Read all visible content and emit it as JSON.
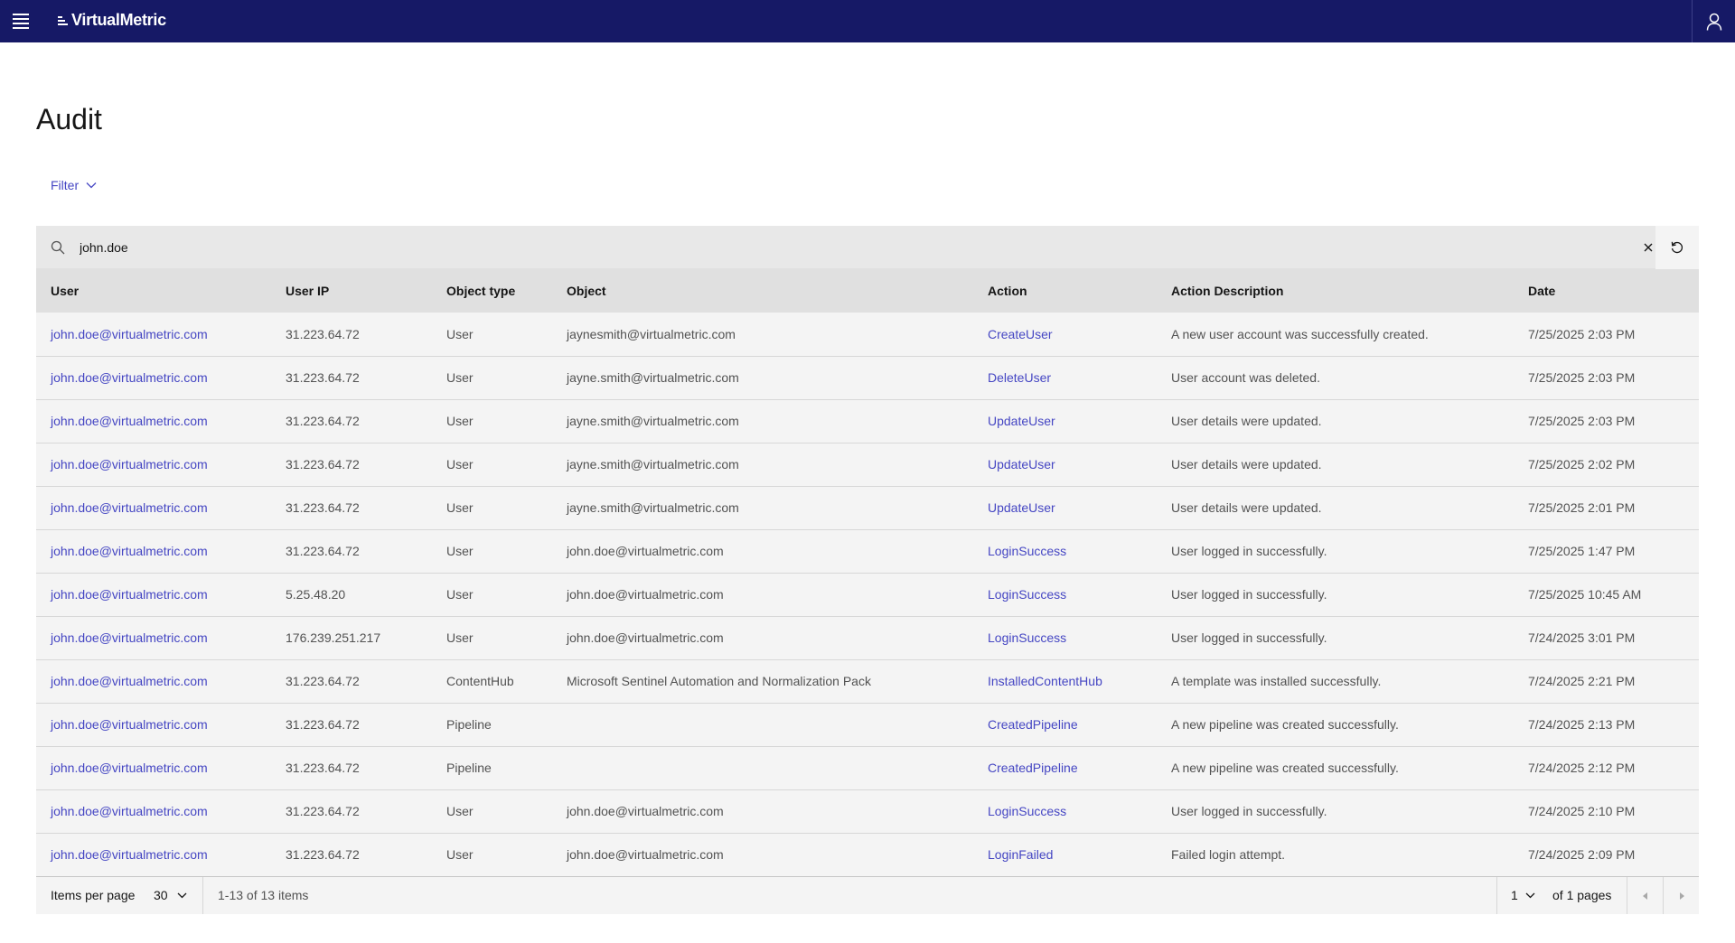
{
  "header": {
    "brand": "VirtualMetric"
  },
  "page": {
    "title": "Audit"
  },
  "filter": {
    "label": "Filter"
  },
  "search": {
    "value": "john.doe"
  },
  "table": {
    "columns": [
      "User",
      "User IP",
      "Object type",
      "Object",
      "Action",
      "Action Description",
      "Date"
    ],
    "rows": [
      {
        "user": "john.doe@virtualmetric.com",
        "ip": "31.223.64.72",
        "object_type": "User",
        "object": "jaynesmith@virtualmetric.com",
        "action": "CreateUser",
        "description": "A new user account was successfully created.",
        "date": "7/25/2025 2:03 PM"
      },
      {
        "user": "john.doe@virtualmetric.com",
        "ip": "31.223.64.72",
        "object_type": "User",
        "object": "jayne.smith@virtualmetric.com",
        "action": "DeleteUser",
        "description": "User account was deleted.",
        "date": "7/25/2025 2:03 PM"
      },
      {
        "user": "john.doe@virtualmetric.com",
        "ip": "31.223.64.72",
        "object_type": "User",
        "object": "jayne.smith@virtualmetric.com",
        "action": "UpdateUser",
        "description": "User details were updated.",
        "date": "7/25/2025 2:03 PM"
      },
      {
        "user": "john.doe@virtualmetric.com",
        "ip": "31.223.64.72",
        "object_type": "User",
        "object": "jayne.smith@virtualmetric.com",
        "action": "UpdateUser",
        "description": "User details were updated.",
        "date": "7/25/2025 2:02 PM"
      },
      {
        "user": "john.doe@virtualmetric.com",
        "ip": "31.223.64.72",
        "object_type": "User",
        "object": "jayne.smith@virtualmetric.com",
        "action": "UpdateUser",
        "description": "User details were updated.",
        "date": "7/25/2025 2:01 PM"
      },
      {
        "user": "john.doe@virtualmetric.com",
        "ip": "31.223.64.72",
        "object_type": "User",
        "object": "john.doe@virtualmetric.com",
        "action": "LoginSuccess",
        "description": "User logged in successfully.",
        "date": "7/25/2025 1:47 PM"
      },
      {
        "user": "john.doe@virtualmetric.com",
        "ip": "5.25.48.20",
        "object_type": "User",
        "object": "john.doe@virtualmetric.com",
        "action": "LoginSuccess",
        "description": "User logged in successfully.",
        "date": "7/25/2025 10:45 AM"
      },
      {
        "user": "john.doe@virtualmetric.com",
        "ip": "176.239.251.217",
        "object_type": "User",
        "object": "john.doe@virtualmetric.com",
        "action": "LoginSuccess",
        "description": "User logged in successfully.",
        "date": "7/24/2025 3:01 PM"
      },
      {
        "user": "john.doe@virtualmetric.com",
        "ip": "31.223.64.72",
        "object_type": "ContentHub",
        "object": "Microsoft Sentinel Automation and Normalization Pack",
        "action": "InstalledContentHub",
        "description": "A template was installed successfully.",
        "date": "7/24/2025 2:21 PM"
      },
      {
        "user": "john.doe@virtualmetric.com",
        "ip": "31.223.64.72",
        "object_type": "Pipeline",
        "object": "",
        "action": "CreatedPipeline",
        "description": "A new pipeline was created successfully.",
        "date": "7/24/2025 2:13 PM"
      },
      {
        "user": "john.doe@virtualmetric.com",
        "ip": "31.223.64.72",
        "object_type": "Pipeline",
        "object": "",
        "action": "CreatedPipeline",
        "description": "A new pipeline was created successfully.",
        "date": "7/24/2025 2:12 PM"
      },
      {
        "user": "john.doe@virtualmetric.com",
        "ip": "31.223.64.72",
        "object_type": "User",
        "object": "john.doe@virtualmetric.com",
        "action": "LoginSuccess",
        "description": "User logged in successfully.",
        "date": "7/24/2025 2:10 PM"
      },
      {
        "user": "john.doe@virtualmetric.com",
        "ip": "31.223.64.72",
        "object_type": "User",
        "object": "john.doe@virtualmetric.com",
        "action": "LoginFailed",
        "description": "Failed login attempt.",
        "date": "7/24/2025 2:09 PM"
      }
    ]
  },
  "pagination": {
    "items_per_page_label": "Items per page",
    "items_per_page": "30",
    "range": "1-13 of 13 items",
    "current_page": "1",
    "of_pages": "of 1 pages"
  },
  "colors": {
    "topbar": "#161966",
    "link": "#4546c3"
  },
  "icons": [
    "hamburger-icon",
    "user-icon",
    "chevron-down-icon",
    "search-icon",
    "close-icon",
    "refresh-icon",
    "caret-left-icon",
    "caret-right-icon"
  ]
}
